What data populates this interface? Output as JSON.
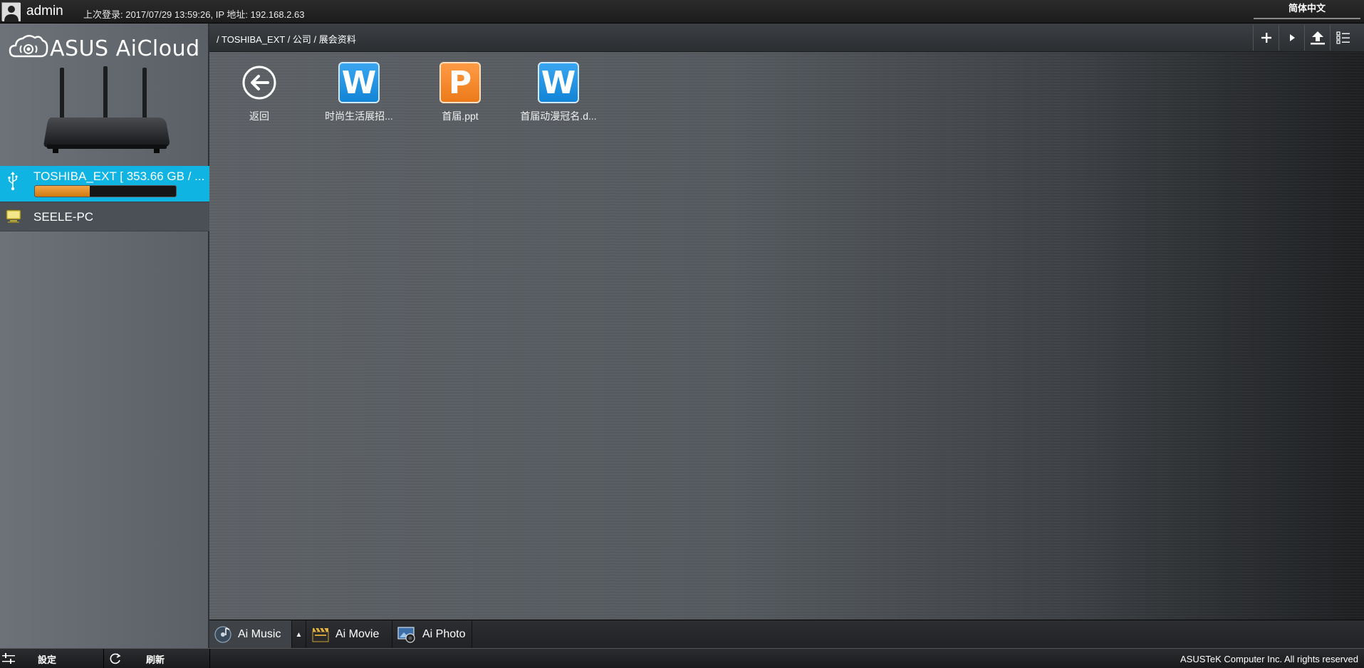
{
  "topbar": {
    "username": "admin",
    "last_login": "上次登录: 2017/07/29 13:59:26, IP 地址: 192.168.2.63",
    "language": "简体中文"
  },
  "sidebar": {
    "logo_text": "ASUS AiCloud",
    "devices": [
      {
        "label": "TOSHIBA_EXT [ 353.66 GB / ...",
        "icon": "usb-icon",
        "usage_fraction": 0.39
      },
      {
        "label": "SEELE-PC",
        "icon": "computer-icon"
      }
    ]
  },
  "main": {
    "path": "/ TOSHIBA_EXT / 公司 / 展会资料",
    "files": [
      {
        "name": "返回",
        "icon": "back-arrow-icon",
        "type": "back"
      },
      {
        "name": "时尚生活展招...",
        "icon": "word-icon",
        "type": "word",
        "glyph": "W"
      },
      {
        "name": "首届.ppt",
        "icon": "powerpoint-icon",
        "type": "ppt",
        "glyph": "P"
      },
      {
        "name": "首届动漫冠名.d...",
        "icon": "word-icon",
        "type": "word",
        "glyph": "W"
      }
    ]
  },
  "appbar": {
    "music": "Ai Music",
    "movie": "Ai Movie",
    "photo": "Ai Photo"
  },
  "footer": {
    "settings": "設定",
    "refresh": "刷新",
    "copyright": "ASUSTeK Computer Inc. All rights reserved"
  },
  "colors": {
    "accent": "#0fb4e3",
    "usage_fill": "#e58d22",
    "word": "#1e90e0",
    "ppt": "#f58220"
  }
}
